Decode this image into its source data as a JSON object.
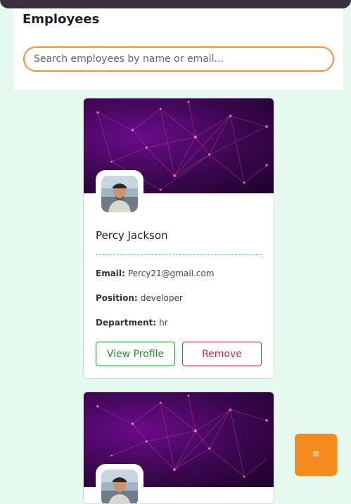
{
  "header": {
    "title": "Employees",
    "search_placeholder": "Search employees by name or email..."
  },
  "employees": [
    {
      "name": "Percy Jackson",
      "email_label": "Email:",
      "email": "Percy21@gmail.com",
      "position_label": "Position:",
      "position": "developer",
      "department_label": "Department:",
      "department": "hr",
      "view_label": "View Profile",
      "remove_label": "Remove"
    },
    {
      "name": "",
      "email_label": "",
      "email": "",
      "position_label": "",
      "position": "",
      "department_label": "",
      "department": "",
      "view_label": "",
      "remove_label": ""
    }
  ],
  "fab": {
    "icon": "menu-icon",
    "glyph": "≡"
  },
  "colors": {
    "background": "#e6f9ee",
    "accent": "#f38c1c",
    "view_button": "#2a8a35",
    "remove_button": "#d0263f",
    "cover": "#4a0866"
  }
}
